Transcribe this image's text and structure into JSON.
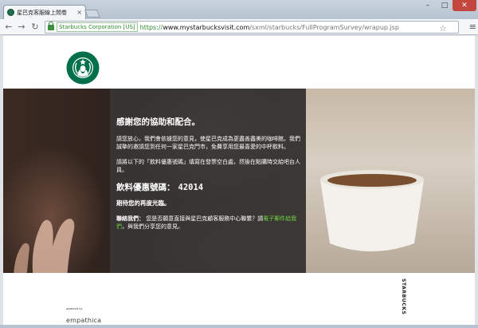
{
  "browser": {
    "tab": {
      "title": "星巴克客服線上問卷",
      "close": "×"
    },
    "window_controls": {
      "minimize": "–",
      "maximize": "□",
      "close": "✕"
    },
    "nav": {
      "back": "←",
      "forward": "→",
      "reload": "↻"
    },
    "omnibox": {
      "ev_badge": "Starbucks Corporation [US]",
      "scheme": "https://",
      "host": "www.mystarbucksvisit.com",
      "path": "/sxml/starbucks/FullProgramSurvey/wrapup.jsp"
    },
    "star": "☆",
    "menu": "≡"
  },
  "page": {
    "thanks": "感謝您的協助和配合。",
    "paragraph1": "請您放心，我們會依據您的意見，使星巴克成為更盡善盡美的咖啡館。我們誠摯的邀請您到任何一家星巴克門市，免費享用您最喜愛的中杯飲料。",
    "paragraph2": "請將以下的「飲料優惠號碼」填寫在發票空白處，然後在點購時交給吧台人員。",
    "code_label": "飲料優惠號碼：",
    "code_value": "42014",
    "wish": "期待您的再度光臨。",
    "contact": {
      "label": "聯絡我們：",
      "text_before": "您是否願意直接與星巴克顧客服務中心聯繫？請",
      "link": "電子郵件給我們",
      "text_after": "，與我們分享您的意見。"
    },
    "footer": {
      "powered_by": "powered by",
      "brand": "empathica",
      "wordmark": "STARBUCKS"
    }
  },
  "colors": {
    "starbucks_green": "#00704A",
    "link_green": "#6ECF44"
  },
  "icons": {
    "favicon": "starbucks-siren-icon",
    "logo": "starbucks-siren-logo"
  }
}
